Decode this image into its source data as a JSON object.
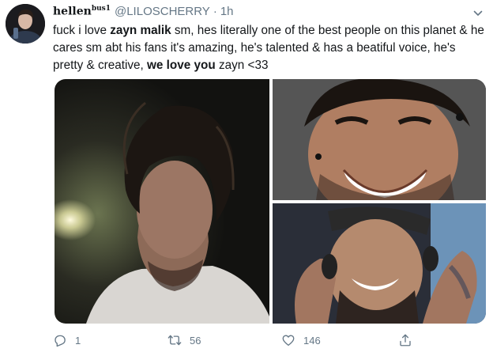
{
  "tweet": {
    "display_name": "hellen",
    "display_name_sup": "bus1",
    "handle": "@LILOSCHERRY",
    "separator": "·",
    "time": "1h",
    "text": {
      "p1": "fuck i love ",
      "b1": "zayn malik",
      "p2": " sm, hes literally one of the best people on this planet & he cares sm abt his fans it's amazing, he's talented & has a beatiful voice, he's pretty & creative, ",
      "b2": "we love you",
      "p3": " zayn <33"
    }
  },
  "actions": {
    "reply_count": "1",
    "retweet_count": "56",
    "like_count": "146"
  },
  "icons": {
    "reply": "reply-icon",
    "retweet": "retweet-icon",
    "like": "heart-icon",
    "share": "share-icon",
    "caret": "chevron-down-icon"
  },
  "colors": {
    "text": "#14171a",
    "muted": "#657786"
  }
}
